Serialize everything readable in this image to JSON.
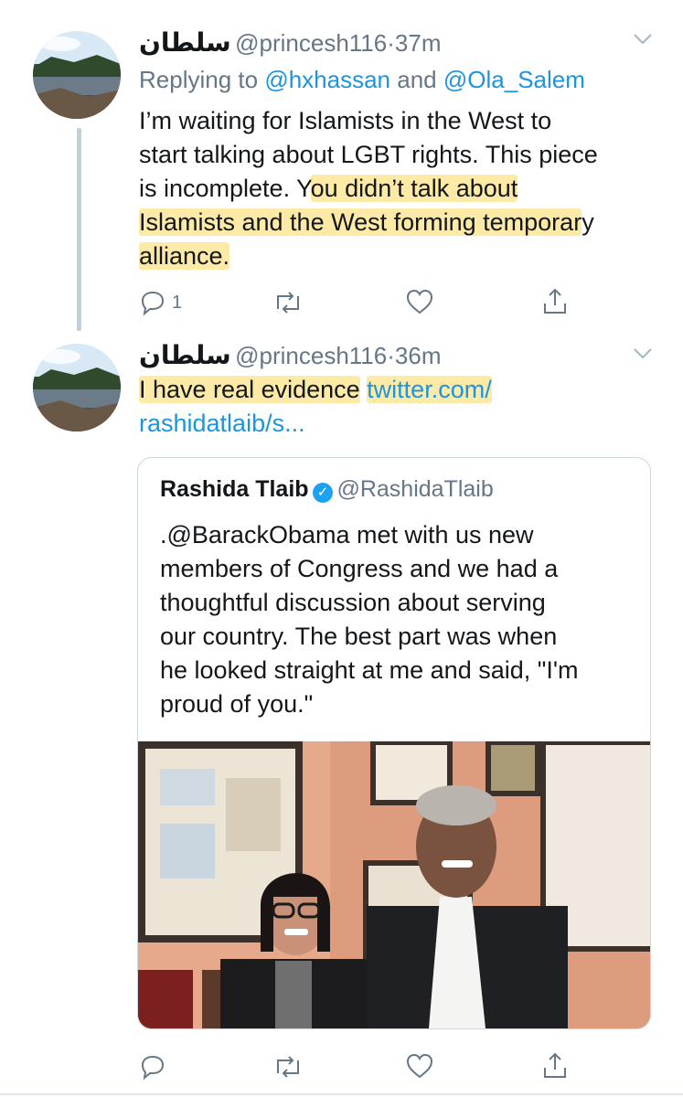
{
  "tweet1": {
    "author_name": "سلطان",
    "handle": "@princesh116",
    "dot": "·",
    "time": "37m",
    "replying_prefix": "Replying to",
    "reply_user_1": "@hxhassan",
    "reply_and": "and",
    "reply_user_2": "@Ola_Salem",
    "text_line1": "I’m waiting for Islamists in the West to",
    "text_line2": "start talking about LGBT rights. This piece",
    "text_line3_a": "is incomplete. Y",
    "text_line3_b": "ou didn’t talk about",
    "text_line4_a": "Islamists and the West forming temporar",
    "text_line4_b": "y",
    "text_line5": "alliance.",
    "reply_count": "1"
  },
  "tweet2": {
    "author_name": "سلطان",
    "handle": "@princesh116",
    "dot": "·",
    "time": "36m",
    "text": "I have real evidence",
    "link_line1": "twitter.com/",
    "link_line2": "rashidatlaib/s..."
  },
  "quote": {
    "name": "Rashida Tlaib",
    "verified_mark": "✓",
    "handle": "@RashidaTlaib",
    "lines": [
      ".@BarackObama met with us new",
      "members of Congress and we had a",
      "thoughtful discussion about serving",
      "our country. The best part was when",
      "he looked straight at me and said, \"I'm",
      "proud of you.\""
    ]
  },
  "colors": {
    "link": "#1b95e0",
    "highlight": "#fcde78",
    "muted": "#657786"
  },
  "icons": [
    "reply-icon",
    "retweet-icon",
    "like-icon",
    "share-icon",
    "chevron-down-icon",
    "verified-icon"
  ]
}
